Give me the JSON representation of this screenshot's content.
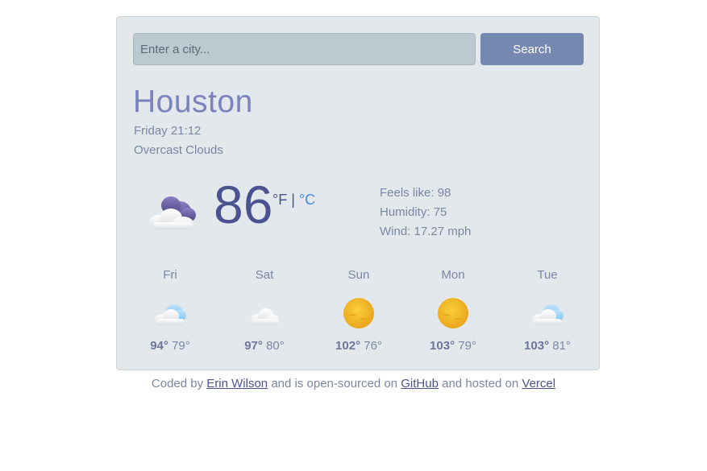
{
  "search": {
    "placeholder": "Enter a city...",
    "value": "",
    "button_label": "Search"
  },
  "current": {
    "city": "Houston",
    "datetime": "Friday 21:12",
    "description": "Overcast Clouds",
    "icon": "overcast-clouds-icon",
    "temperature": "86",
    "unit_f": "°F",
    "unit_sep": "|",
    "unit_c": "°C"
  },
  "details": {
    "feels_like": "Feels like: 98",
    "humidity": "Humidity: 75",
    "wind": "Wind: 17.27 mph"
  },
  "forecast": [
    {
      "day": "Fri",
      "icon": "few-clouds-icon",
      "high": "94°",
      "low": "79°"
    },
    {
      "day": "Sat",
      "icon": "scattered-clouds-icon",
      "high": "97°",
      "low": "80°"
    },
    {
      "day": "Sun",
      "icon": "sun-icon",
      "high": "102°",
      "low": "76°"
    },
    {
      "day": "Mon",
      "icon": "sun-icon",
      "high": "103°",
      "low": "79°"
    },
    {
      "day": "Tue",
      "icon": "few-clouds-icon",
      "high": "103°",
      "low": "81°"
    }
  ],
  "footer": {
    "prefix": "Coded by",
    "author": "Erin Wilson",
    "middle": "and is open-sourced on",
    "github": "GitHub",
    "hosted": "and hosted on",
    "vercel": "Vercel"
  },
  "colors": {
    "accent": "#7588b0",
    "city": "#7a83bd",
    "temperature": "#4b5290",
    "link": "#4b5290",
    "celsius": "#4b86e6"
  }
}
